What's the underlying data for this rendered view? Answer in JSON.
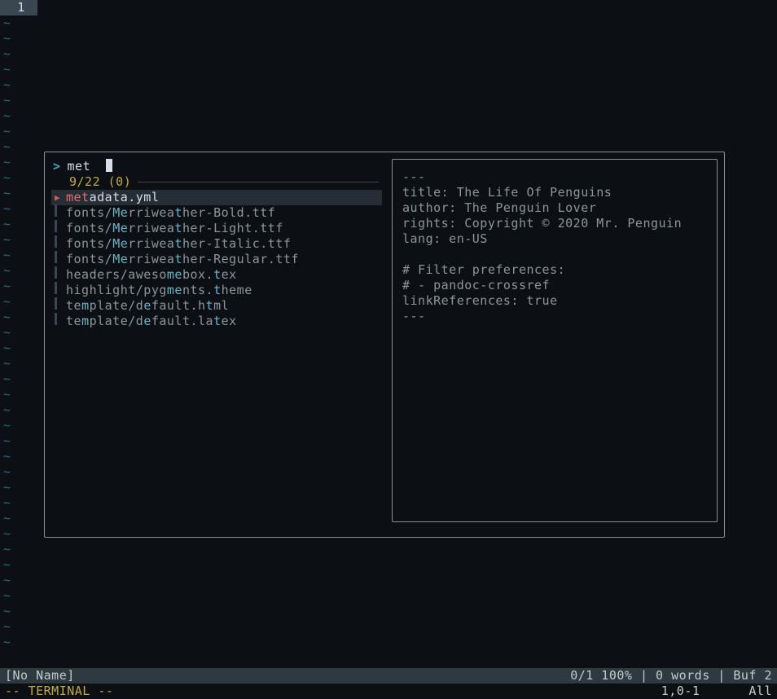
{
  "tab": {
    "label": "1"
  },
  "tilde_count": 41,
  "fzf": {
    "prompt_symbol": ">",
    "query": "met",
    "count": "9/22 (0)",
    "results": [
      {
        "segments": [
          [
            "met",
            true
          ],
          [
            "adata.yml",
            false
          ]
        ],
        "selected": true
      },
      {
        "segments": [
          [
            "fonts/",
            false
          ],
          [
            "Me",
            true
          ],
          [
            "rriwea",
            false
          ],
          [
            "t",
            true
          ],
          [
            "her-Bold.ttf",
            false
          ]
        ],
        "selected": false
      },
      {
        "segments": [
          [
            "fonts/",
            false
          ],
          [
            "Me",
            true
          ],
          [
            "rriwea",
            false
          ],
          [
            "t",
            true
          ],
          [
            "her-Light.ttf",
            false
          ]
        ],
        "selected": false
      },
      {
        "segments": [
          [
            "fonts/",
            false
          ],
          [
            "Me",
            true
          ],
          [
            "rriwea",
            false
          ],
          [
            "t",
            true
          ],
          [
            "her-Italic.ttf",
            false
          ]
        ],
        "selected": false
      },
      {
        "segments": [
          [
            "fonts/",
            false
          ],
          [
            "Me",
            true
          ],
          [
            "rriwea",
            false
          ],
          [
            "t",
            true
          ],
          [
            "her-Regular.ttf",
            false
          ]
        ],
        "selected": false
      },
      {
        "segments": [
          [
            "headers/aweso",
            false
          ],
          [
            "me",
            true
          ],
          [
            "box.",
            false
          ],
          [
            "t",
            true
          ],
          [
            "ex",
            false
          ]
        ],
        "selected": false
      },
      {
        "segments": [
          [
            "highlight/pyg",
            false
          ],
          [
            "me",
            true
          ],
          [
            "nts.",
            false
          ],
          [
            "t",
            true
          ],
          [
            "heme",
            false
          ]
        ],
        "selected": false
      },
      {
        "segments": [
          [
            "te",
            false
          ],
          [
            "m",
            true
          ],
          [
            "plate/d",
            false
          ],
          [
            "e",
            true
          ],
          [
            "fault.h",
            false
          ],
          [
            "t",
            true
          ],
          [
            "ml",
            false
          ]
        ],
        "selected": false
      },
      {
        "segments": [
          [
            "te",
            false
          ],
          [
            "m",
            true
          ],
          [
            "plate/d",
            false
          ],
          [
            "e",
            true
          ],
          [
            "fault.la",
            false
          ],
          [
            "t",
            true
          ],
          [
            "ex",
            false
          ]
        ],
        "selected": false
      }
    ],
    "preview": [
      "---",
      "title: The Life Of Penguins",
      "author: The Penguin Lover",
      "rights: Copyright © 2020 Mr. Penguin",
      "lang: en-US",
      "",
      "# Filter preferences:",
      "# - pandoc-crossref",
      "linkReferences: true",
      "---"
    ]
  },
  "statusline": {
    "left": "[No Name]",
    "right": "0/1 100% | 0 words | Buf 2"
  },
  "modeline": {
    "left": "-- TERMINAL --",
    "pos": "1,0-1",
    "all": "All"
  }
}
